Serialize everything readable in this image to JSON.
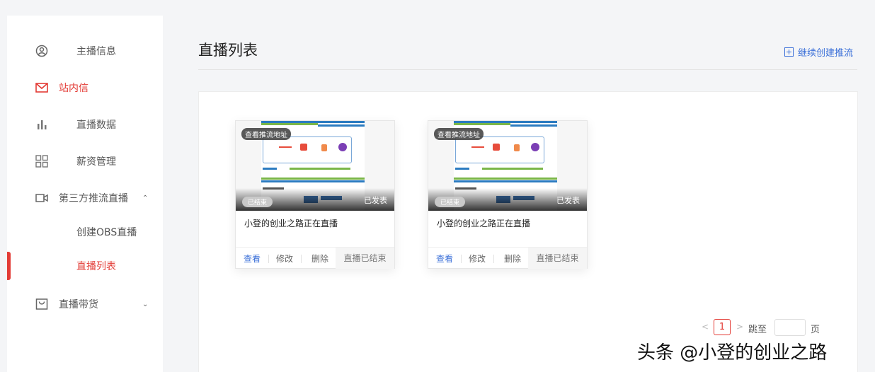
{
  "sidebar": {
    "items": [
      {
        "label": "主播信息",
        "icon": "user-circle-icon"
      },
      {
        "label": "站内信",
        "icon": "mail-icon"
      },
      {
        "label": "直播数据",
        "icon": "bar-chart-icon"
      },
      {
        "label": "薪资管理",
        "icon": "grid-icon"
      },
      {
        "label": "第三方推流直播",
        "icon": "video-camera-icon"
      },
      {
        "label": "创建OBS直播"
      },
      {
        "label": "直播列表"
      },
      {
        "label": "直播带货",
        "icon": "shopping-bag-icon"
      }
    ],
    "active_color": "#e33b35"
  },
  "main": {
    "title": "直播列表",
    "create_link": "继续创建推流",
    "link_color": "#3a6fd8"
  },
  "cards": [
    {
      "push_badge": "查看推流地址",
      "ended_badge": "已结束",
      "published_badge": "已发表",
      "title": "小登的创业之路正在直播",
      "actions": {
        "view": "查看",
        "edit": "修改",
        "delete": "删除"
      },
      "status": "直播已结束"
    },
    {
      "push_badge": "查看推流地址",
      "ended_badge": "已结束",
      "published_badge": "已发表",
      "title": "小登的创业之路正在直播",
      "actions": {
        "view": "查看",
        "edit": "修改",
        "delete": "删除"
      },
      "status": "直播已结束"
    }
  ],
  "pagination": {
    "current_page": "1",
    "jump_label": "跳至",
    "page_unit": "页",
    "jump_value": ""
  },
  "watermark": "头条 @小登的创业之路"
}
